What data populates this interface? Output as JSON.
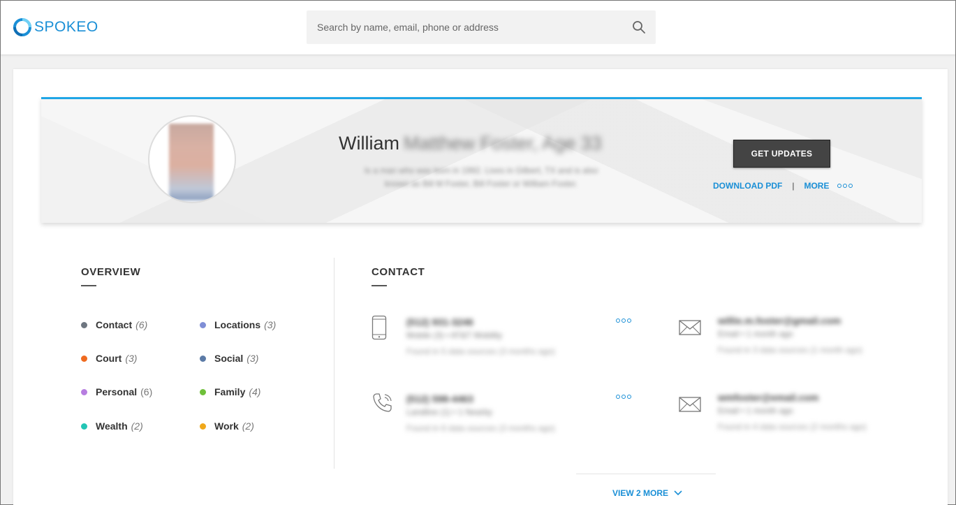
{
  "header": {
    "brand": "SPOKEO",
    "search_placeholder": "Search by name, email, phone or address"
  },
  "profile": {
    "first_name": "William",
    "redacted_name": "Matthew Foster, Age 33",
    "summary_line1": "Is a man who was born in 1992. Lives in Gilbert, TX and is also",
    "summary_line2": "known as Bill M Foster, Bill Foster or William Foster.",
    "get_updates_label": "GET UPDATES",
    "download_pdf_label": "DOWNLOAD PDF",
    "separator": "|",
    "more_label": "MORE"
  },
  "overview": {
    "title": "OVERVIEW",
    "items": [
      {
        "label": "Contact",
        "count": "(6)",
        "color": "#6e7680"
      },
      {
        "label": "Locations",
        "count": "(3)",
        "color": "#7f8ed6"
      },
      {
        "label": "Court",
        "count": "(3)",
        "color": "#ef6a1f"
      },
      {
        "label": "Social",
        "count": "(3)",
        "color": "#5b7aa6"
      },
      {
        "label": "Personal",
        "count": "(6)",
        "color": "#b77de0"
      },
      {
        "label": "Family",
        "count": "(4)",
        "color": "#6fc03a"
      },
      {
        "label": "Wealth",
        "count": "(2)",
        "color": "#23c5b5"
      },
      {
        "label": "Work",
        "count": "(2)",
        "color": "#f0a81a"
      }
    ]
  },
  "contact": {
    "title": "CONTACT",
    "phones": [
      {
        "number": "(512) 931-3246",
        "type": "Mobile (3) • AT&T Mobility",
        "found": "Found in 5 data sources (3 months ago)"
      },
      {
        "number": "(512) 598-4463",
        "type": "Landline (1) • 1 Nearby",
        "found": "Found in 6 data sources (3 months ago)"
      }
    ],
    "emails": [
      {
        "address": "willie.m.foster@gmail.com",
        "type": "Email • 1 month ago",
        "found": "Found in 3 data sources (1 month ago)"
      },
      {
        "address": "wmfoster@email.com",
        "type": "Email • 1 month ago",
        "found": "Found in 4 data sources (2 months ago)"
      }
    ],
    "view_more_label": "VIEW 2 MORE"
  },
  "colors": {
    "accent": "#1a8fd6",
    "profile_top_border": "#1fa6e6",
    "button_dark": "#444444"
  },
  "icons": [
    "spokeo-logo-icon",
    "search-icon",
    "more-dots-icon",
    "mobile-phone-icon",
    "landline-phone-icon",
    "envelope-icon",
    "chevron-down-icon"
  ]
}
